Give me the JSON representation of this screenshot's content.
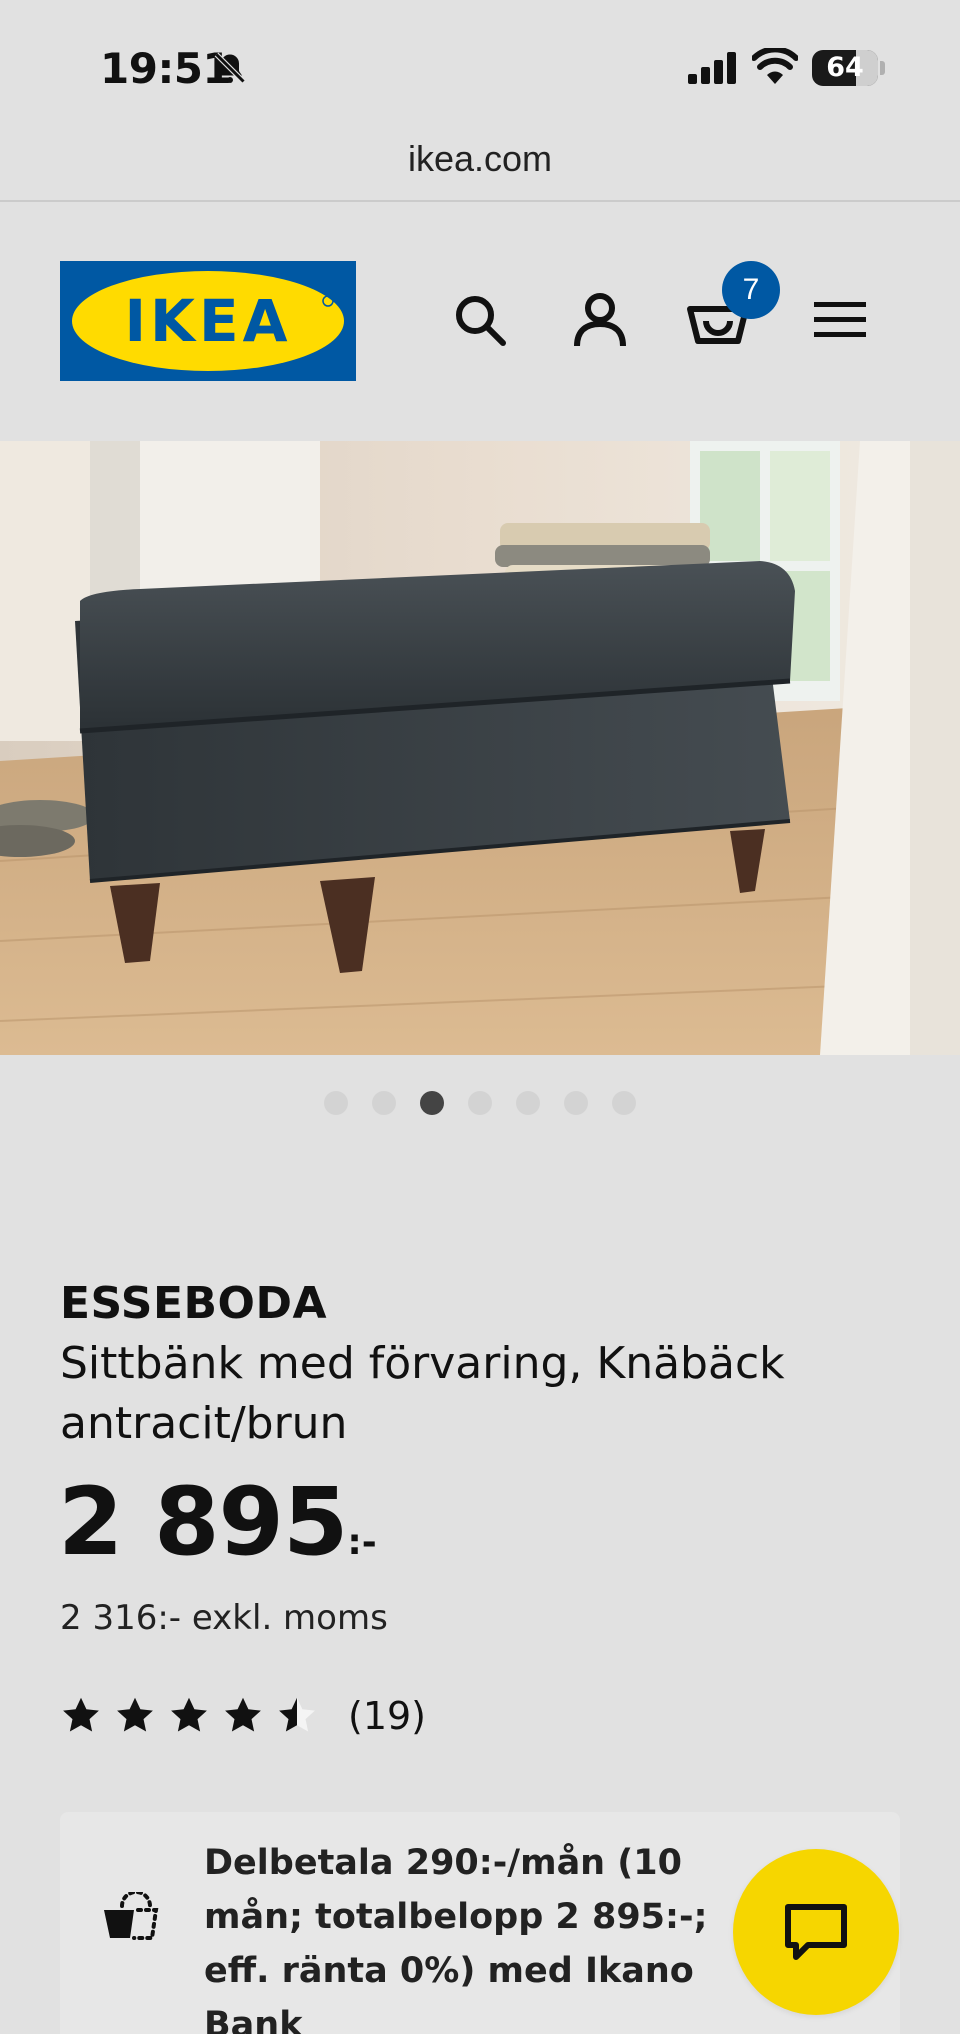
{
  "status_bar": {
    "time": "19:51",
    "battery": "64"
  },
  "browser": {
    "url": "ikea.com"
  },
  "header": {
    "logo_text": "IKEA",
    "cart_count": "7"
  },
  "gallery": {
    "total_images": 7,
    "active_index": 2
  },
  "product": {
    "name": "ESSEBODA",
    "description": "Sittbänk med förvaring, Knäbäck antracit/brun",
    "price": "2 895",
    "price_suffix": ":-",
    "price_excl_vat": "2 316:- exkl. moms",
    "rating_value": 4.5,
    "rating_count": "(19)"
  },
  "financing": {
    "text": "Delbetala 290:-/mån (10 mån; totalbelopp 2 895:-; eff. ränta 0%) med Ikano Bank"
  },
  "colors": {
    "ikea_blue": "#0058a3",
    "ikea_yellow": "#ffdb00",
    "chat_yellow": "#f6d600",
    "background": "#e1e1e1"
  },
  "icons": [
    "bell-slash-icon",
    "signal-icon",
    "wifi-icon",
    "battery-icon",
    "search-icon",
    "account-icon",
    "cart-icon",
    "menu-icon",
    "star-icon",
    "installment-icon",
    "chat-icon"
  ]
}
